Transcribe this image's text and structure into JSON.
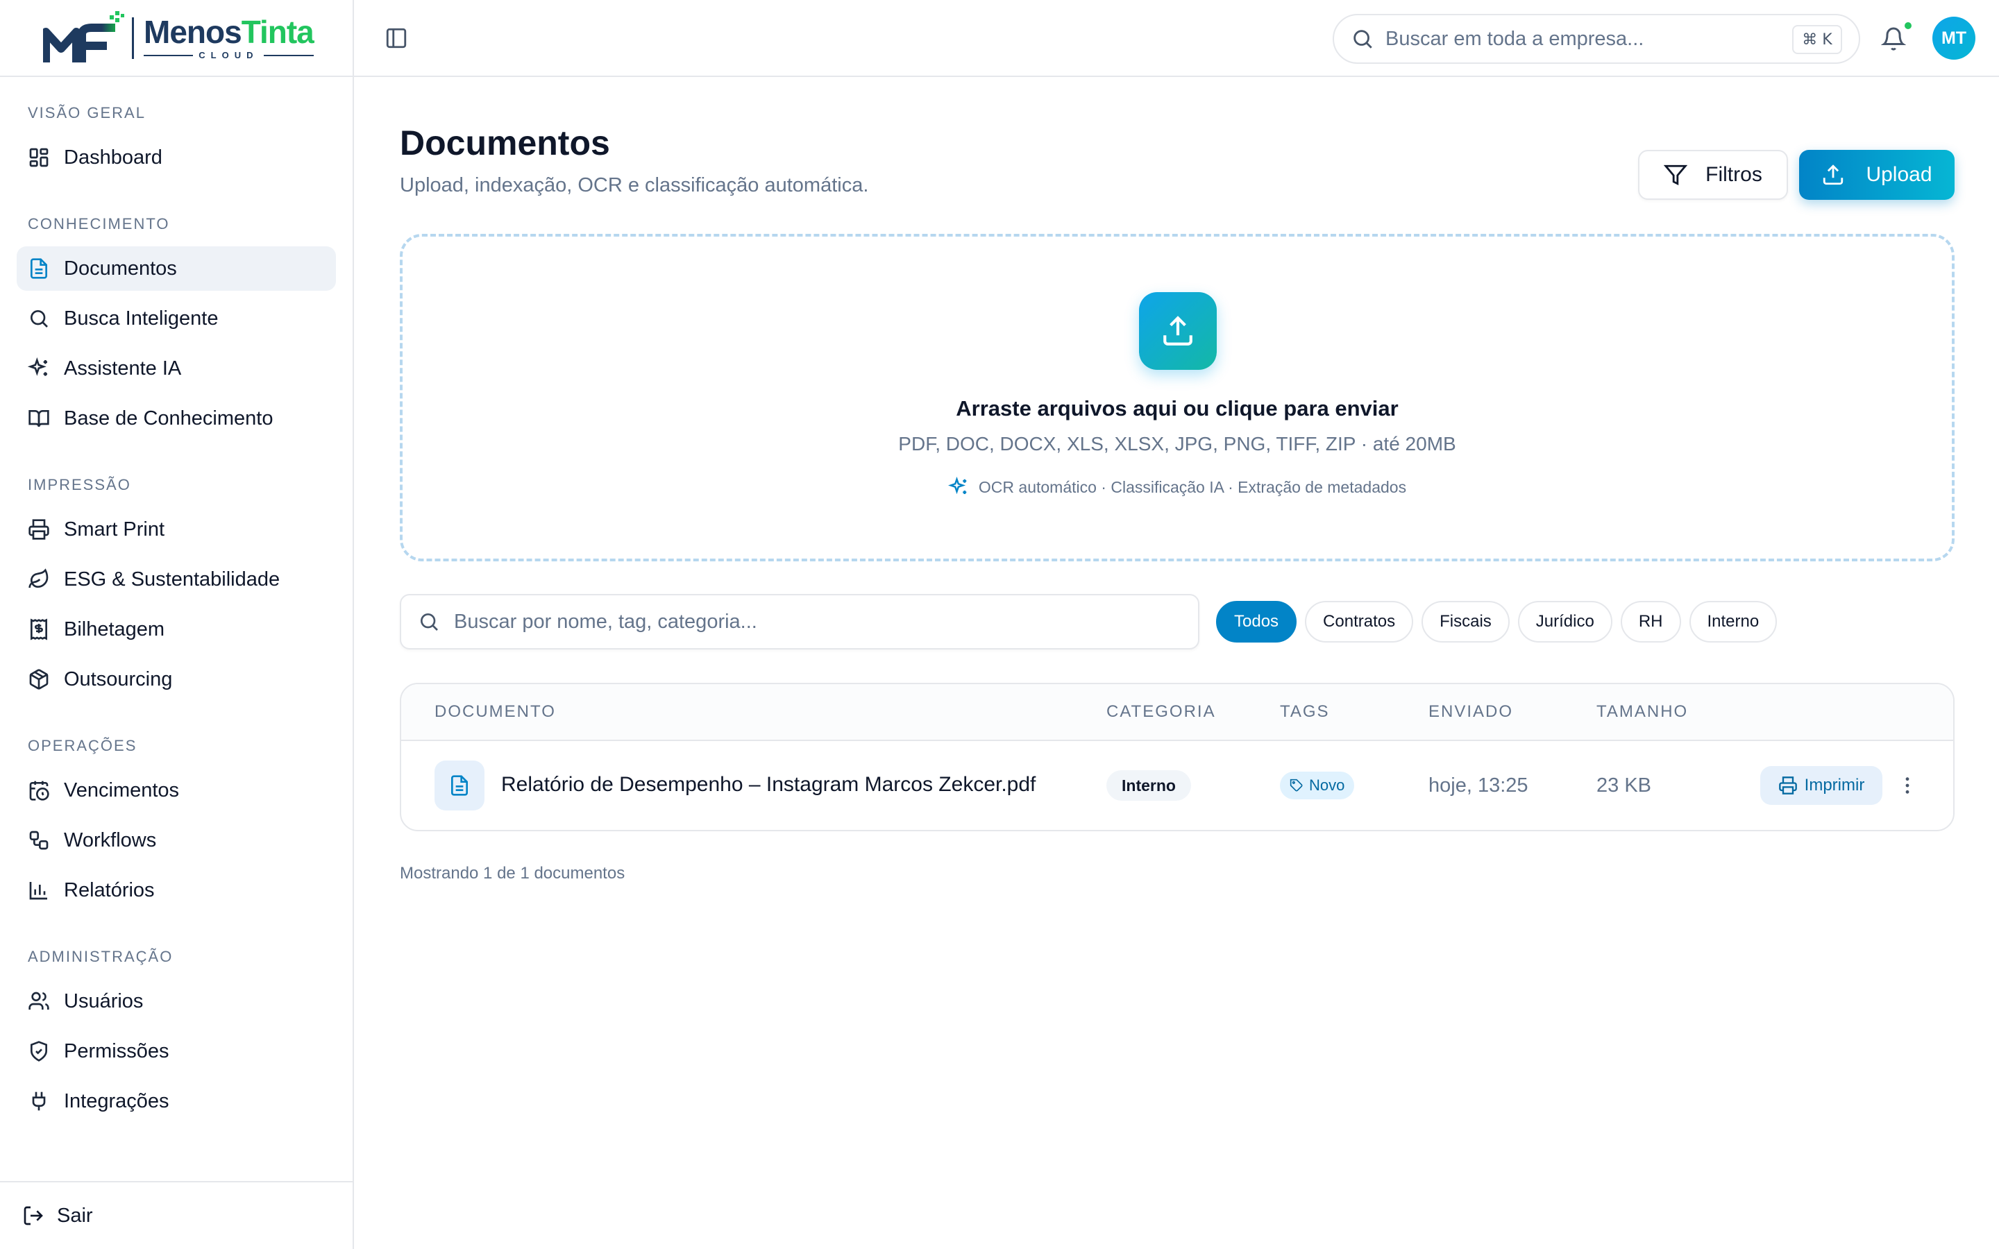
{
  "brand": {
    "name_part1": "Menos",
    "name_part2": "Tinta",
    "tagline": "CLOUD",
    "colors": {
      "navy": "#1e3a5f",
      "green": "#22c55e",
      "accent": "#0284c7"
    }
  },
  "sidebar": {
    "sections": [
      {
        "heading": "VISÃO GERAL",
        "items": [
          {
            "label": "Dashboard",
            "icon": "dashboard-icon"
          }
        ]
      },
      {
        "heading": "CONHECIMENTO",
        "items": [
          {
            "label": "Documentos",
            "icon": "document-icon",
            "active": true
          },
          {
            "label": "Busca Inteligente",
            "icon": "search-icon"
          },
          {
            "label": "Assistente IA",
            "icon": "sparkles-icon"
          },
          {
            "label": "Base de Conhecimento",
            "icon": "book-icon"
          }
        ]
      },
      {
        "heading": "IMPRESSÃO",
        "items": [
          {
            "label": "Smart Print",
            "icon": "printer-icon"
          },
          {
            "label": "ESG & Sustentabilidade",
            "icon": "leaf-icon"
          },
          {
            "label": "Bilhetagem",
            "icon": "receipt-icon"
          },
          {
            "label": "Outsourcing",
            "icon": "package-icon"
          }
        ]
      },
      {
        "heading": "OPERAÇÕES",
        "items": [
          {
            "label": "Vencimentos",
            "icon": "calendar-clock-icon"
          },
          {
            "label": "Workflows",
            "icon": "workflow-icon"
          },
          {
            "label": "Relatórios",
            "icon": "bar-chart-icon"
          }
        ]
      },
      {
        "heading": "ADMINISTRAÇÃO",
        "items": [
          {
            "label": "Usuários",
            "icon": "users-icon"
          },
          {
            "label": "Permissões",
            "icon": "shield-icon"
          },
          {
            "label": "Integrações",
            "icon": "plug-icon"
          }
        ]
      }
    ],
    "logout_label": "Sair"
  },
  "topbar": {
    "search_placeholder": "Buscar em toda a empresa...",
    "shortcut": "⌘ K",
    "avatar_initials": "MT"
  },
  "page": {
    "title": "Documentos",
    "subtitle": "Upload, indexação, OCR e classificação automática.",
    "filters_label": "Filtros",
    "upload_label": "Upload"
  },
  "dropzone": {
    "title": "Arraste arquivos aqui ou clique para enviar",
    "formats": "PDF, DOC, DOCX, XLS, XLSX, JPG, PNG, TIFF, ZIP · até 20MB",
    "features": "OCR automático · Classificação IA · Extração de metadados"
  },
  "doc_search": {
    "placeholder": "Buscar por nome, tag, categoria..."
  },
  "filter_chips": [
    {
      "label": "Todos",
      "active": true
    },
    {
      "label": "Contratos"
    },
    {
      "label": "Fiscais"
    },
    {
      "label": "Jurídico"
    },
    {
      "label": "RH"
    },
    {
      "label": "Interno"
    }
  ],
  "table": {
    "columns": [
      "DOCUMENTO",
      "CATEGORIA",
      "TAGS",
      "ENVIADO",
      "TAMANHO"
    ],
    "rows": [
      {
        "name": "Relatório de Desempenho – Instagram Marcos Zekcer.pdf",
        "category": "Interno",
        "tag": "Novo",
        "sent": "hoje, 13:25",
        "size": "23 KB",
        "action_label": "Imprimir"
      }
    ]
  },
  "footer": {
    "count_text": "Mostrando 1 de 1 documentos"
  }
}
